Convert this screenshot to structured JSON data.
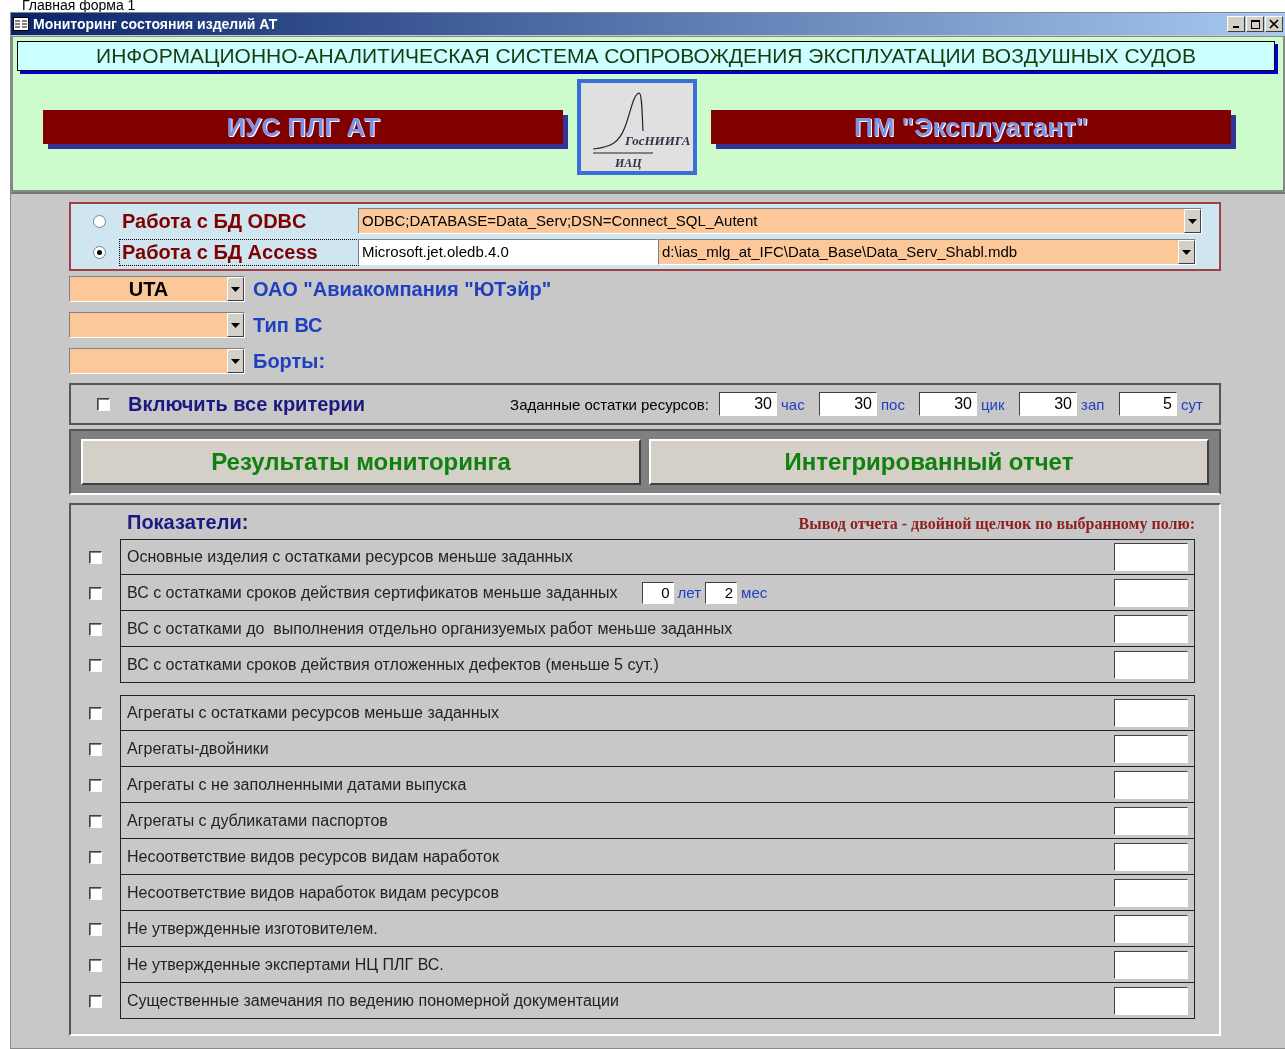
{
  "caption": "Главная форма 1",
  "window": {
    "title": "Мониторинг состояния изделий АТ"
  },
  "banner": "ИНФОРМАЦИОННО-АНАЛИТИЧЕСКАЯ СИСТЕМА СОПРОВОЖДЕНИЯ ЭКСПЛУАТАЦИИ ВОЗДУШНЫХ СУДОВ",
  "panels": [
    "ИУС ПЛГ АТ",
    "ПМ \"Эксплуатант\""
  ],
  "logo": {
    "text": "ГосНИИГА",
    "subtext": "ИАЦ"
  },
  "db_options": [
    {
      "label": "Работа с БД ODBC",
      "selected": false,
      "fields": [
        {
          "kind": "combo",
          "value": "ODBC;DATABASE=Data_Serv;DSN=Connect_SQL_Autent"
        }
      ]
    },
    {
      "label": "Работа с БД Access",
      "selected": true,
      "fields": [
        {
          "kind": "text",
          "value": "Microsoft.jet.oledb.4.0"
        },
        {
          "kind": "combo",
          "value": "d:\\ias_mlg_at_IFC\\Data_Base\\Data_Serv_Shabl.mdb"
        }
      ]
    }
  ],
  "filters": [
    {
      "value": "UTA",
      "label": "ОАО \"Авиакомпания \"ЮТэйр\""
    },
    {
      "label": "Тип ВС"
    },
    {
      "label": "Борты:"
    }
  ],
  "criteria": {
    "label": "Включить все критерии",
    "checked": false,
    "resources_label": "Заданные остатки ресурсов:",
    "resources": [
      {
        "value": "30",
        "unit": "час"
      },
      {
        "value": "30",
        "unit": "пос"
      },
      {
        "value": "30",
        "unit": "цик"
      },
      {
        "value": "30",
        "unit": "зап"
      },
      {
        "value": "5",
        "unit": "сут"
      }
    ]
  },
  "actions": [
    "Результаты мониторинга",
    "Интегрированный отчет"
  ],
  "indicators": {
    "title": "Показатели:",
    "hint": "Вывод отчета - двойной щелчок по выбранному полю:",
    "groups": [
      [
        {
          "label": "Основные изделия с остатками ресурсов меньше заданных",
          "checked": false
        },
        {
          "label": "ВС с остатками сроков действия сертификатов меньше заданных",
          "checked": false,
          "extras": [
            {
              "value": "0",
              "unit": "лет"
            },
            {
              "value": "2",
              "unit": "мес"
            }
          ]
        },
        {
          "label": "ВС с остатками до  выполнения отдельно организуемых работ меньше заданных",
          "checked": false
        },
        {
          "label": "ВС с остатками сроков действия отложенных дефектов (меньше 5 сут.)",
          "checked": false
        }
      ],
      [
        {
          "label": "Агрегаты с остатками ресурсов меньше заданных",
          "checked": false
        },
        {
          "label": "Агрегаты-двойники",
          "checked": false
        },
        {
          "label": "Агрегаты с не заполненными датами выпуска",
          "checked": false
        },
        {
          "label": "Агрегаты с дубликатами паспортов",
          "checked": false
        },
        {
          "label": "Несоответствие видов ресурсов видам наработок",
          "checked": false
        },
        {
          "label": "Несоответствие видов наработок видам ресурсов",
          "checked": false
        },
        {
          "label": "Не утвержденные изготовителем.",
          "checked": false
        },
        {
          "label": "Не утвержденные экспертами НЦ ПЛГ ВС.",
          "checked": false
        },
        {
          "label": "Существенные замечания по ведению пономерной документации",
          "checked": false
        }
      ]
    ]
  }
}
